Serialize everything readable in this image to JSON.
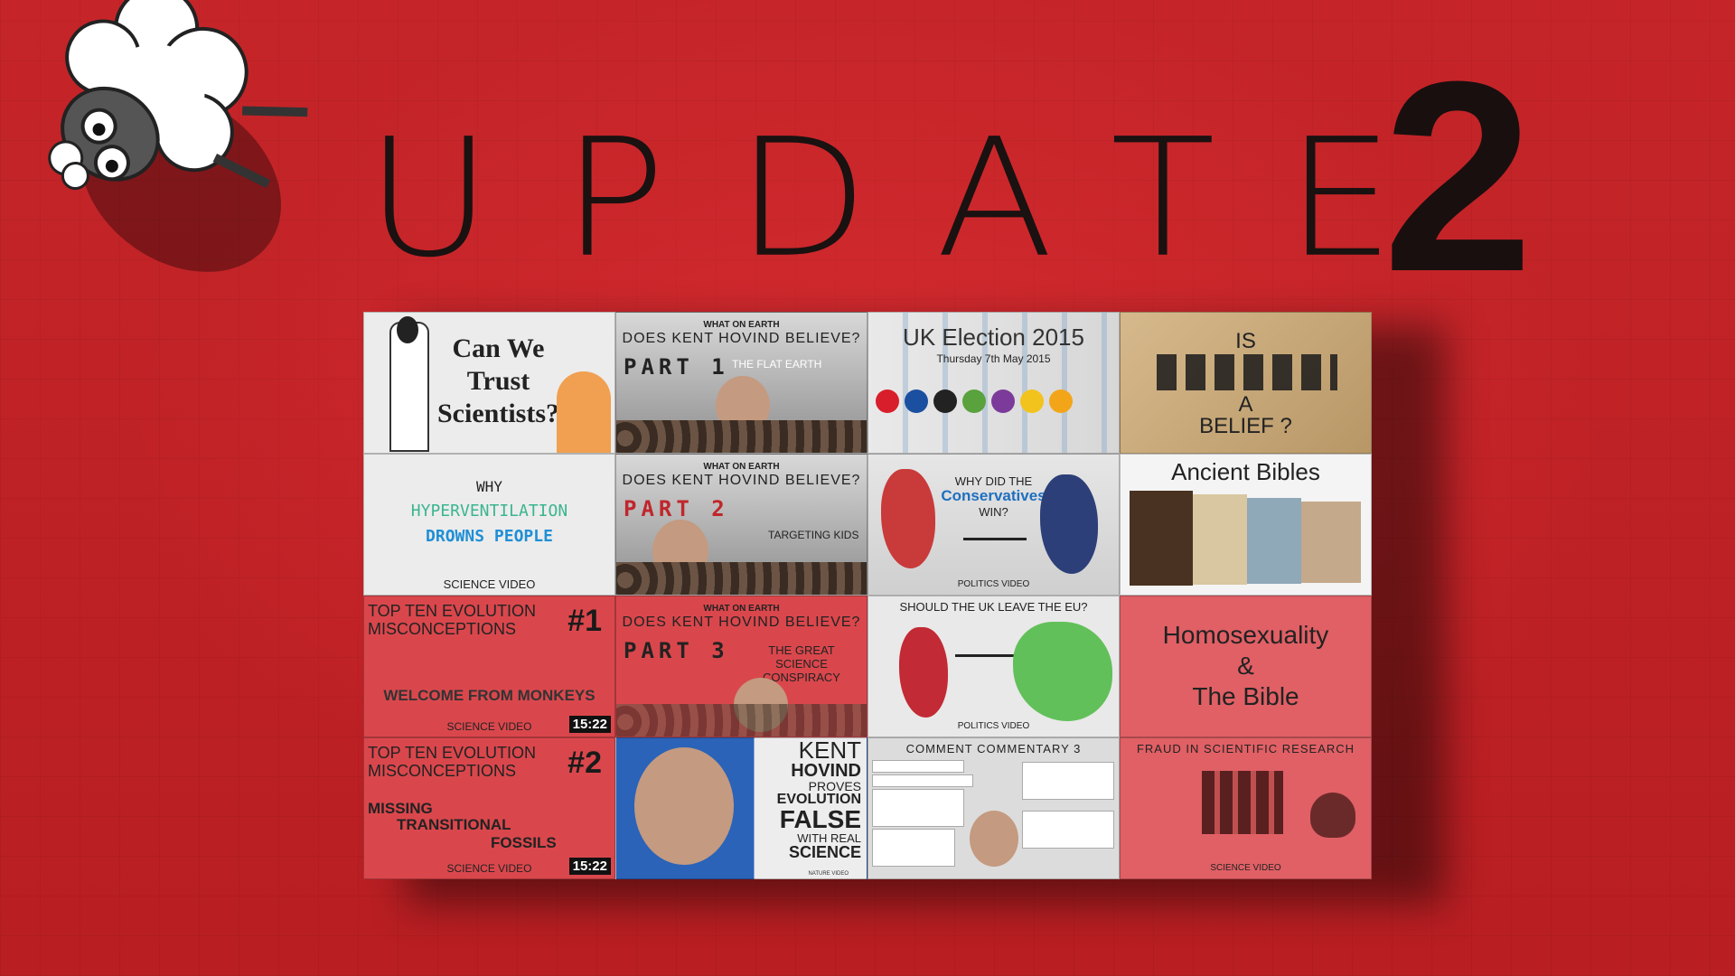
{
  "title": {
    "word": "UPDATE",
    "number": "2"
  },
  "tiles": [
    {
      "line1": "Can We",
      "line2": "Trust",
      "line3": "Scientists?"
    },
    {
      "kicker": "WHAT ON EARTH",
      "headline": "DOES KENT HOVIND BELIEVE?",
      "part": "PART 1",
      "sub": "THE FLAT EARTH"
    },
    {
      "headline": "UK Election 2015",
      "sub": "Thursday 7th May 2015"
    },
    {
      "line1": "IS",
      "line2": "A",
      "line3": "BELIEF ?"
    },
    {
      "line1": "WHY",
      "line2": "HYPERVENTILATION",
      "line3": "DROWNS PEOPLE",
      "footer": "SCIENCE VIDEO"
    },
    {
      "kicker": "WHAT ON EARTH",
      "headline": "DOES KENT HOVIND BELIEVE?",
      "part": "PART 2",
      "sub": "TARGETING KIDS"
    },
    {
      "line1": "WHY DID THE",
      "line2": "Conservatives",
      "line3": "WIN?",
      "footer": "POLITICS VIDEO"
    },
    {
      "headline": "Ancient Bibles"
    },
    {
      "line1": "TOP TEN EVOLUTION",
      "line2": "MISCONCEPTIONS",
      "num": "#1",
      "sub": "WELCOME FROM MONKEYS",
      "footer": "SCIENCE VIDEO",
      "duration": "15:22"
    },
    {
      "kicker": "WHAT ON EARTH",
      "headline": "DOES KENT HOVIND BELIEVE?",
      "part": "PART 3",
      "sub": "THE GREAT SCIENCE CONSPIRACY"
    },
    {
      "headline": "SHOULD THE UK LEAVE THE EU?",
      "footer": "POLITICS VIDEO"
    },
    {
      "line1": "Homosexuality",
      "line2": "&",
      "line3": "The Bible"
    },
    {
      "line1": "TOP TEN EVOLUTION",
      "line2": "MISCONCEPTIONS",
      "num": "#2",
      "sub1": "MISSING",
      "sub2": "TRANSITIONAL",
      "sub3": "FOSSILS",
      "footer": "SCIENCE VIDEO",
      "duration": "15:22"
    },
    {
      "l1": "KENT",
      "l2": "HOVIND",
      "l3": "PROVES",
      "l4": "EVOLUTION",
      "l5": "FALSE",
      "l6": "WITH REAL",
      "l7": "SCIENCE",
      "footer": "NATURE VIDEO"
    },
    {
      "headline": "COMMENT COMMENTARY 3"
    },
    {
      "headline": "FRAUD IN SCIENTIFIC RESEARCH",
      "footer": "SCIENCE VIDEO"
    }
  ],
  "colors": {
    "background": "#c8262b",
    "title": "#1a1111",
    "blue_text": "#1f8fd6",
    "green_text": "#3bb58f"
  }
}
